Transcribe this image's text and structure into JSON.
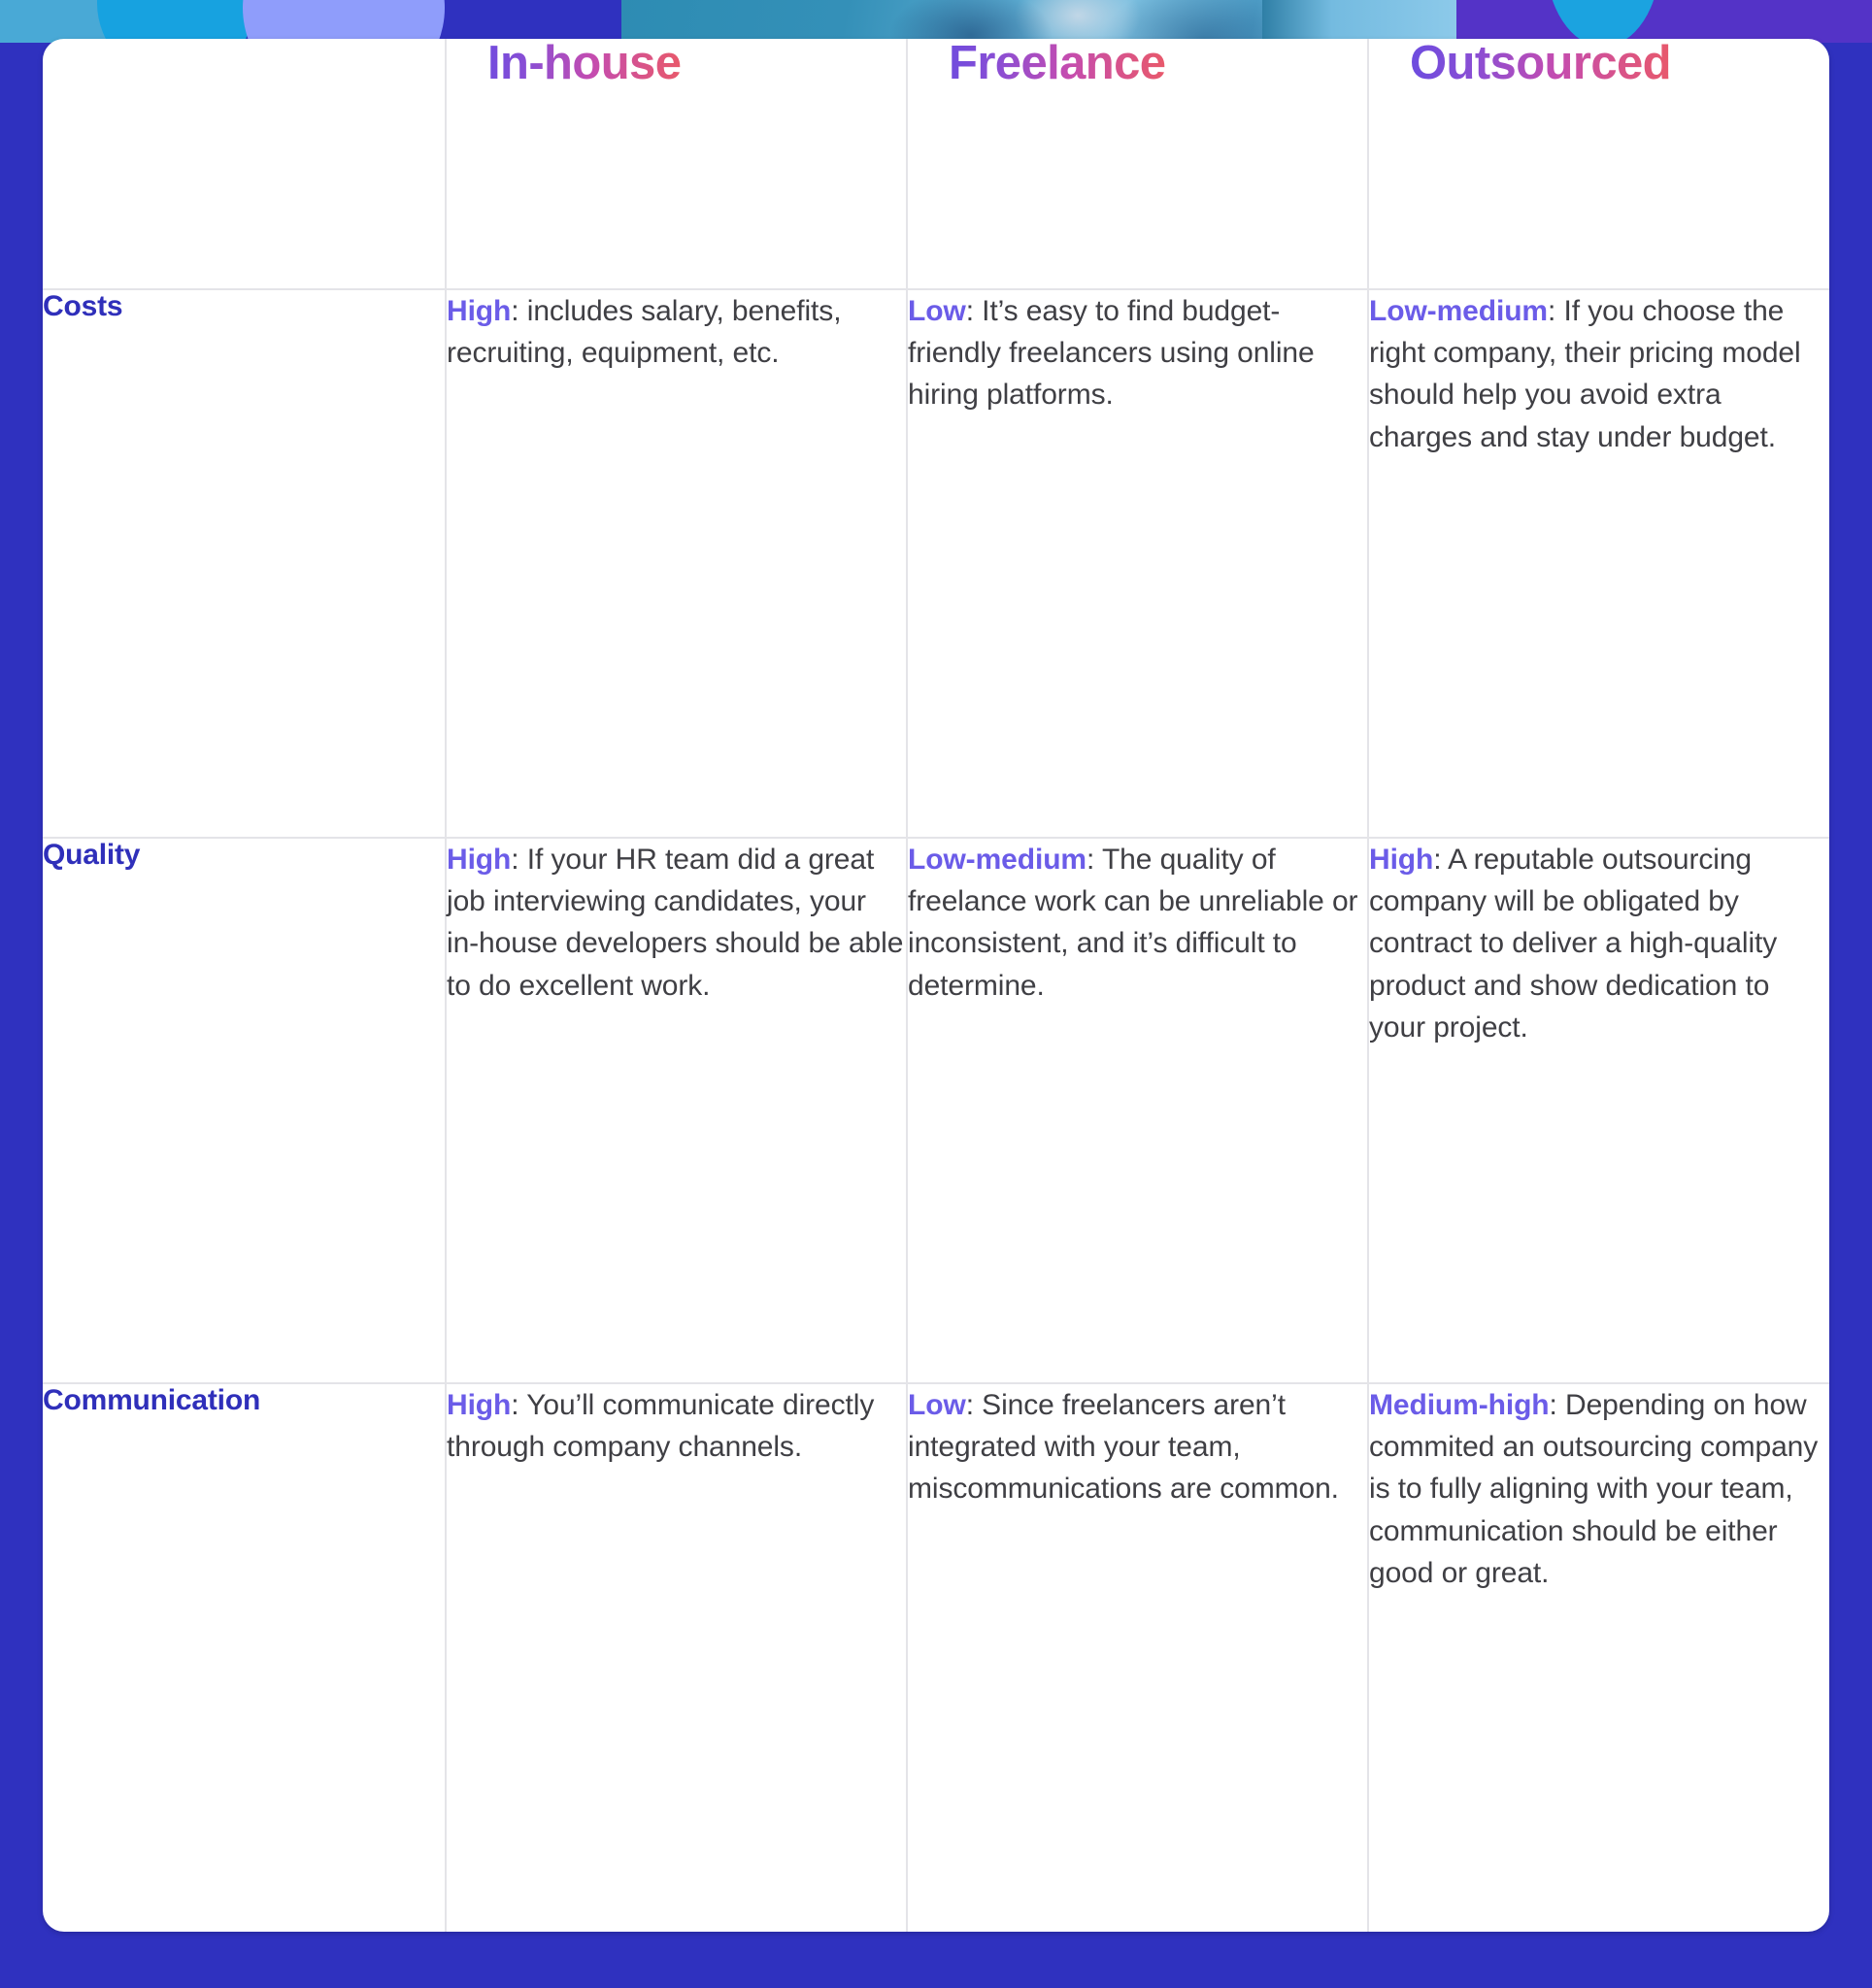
{
  "theme": {
    "page_background": "#2f31bf",
    "card_background": "#ffffff",
    "row_label_color": "#2f2fba",
    "keyword_color": "#6b5ce8",
    "body_text_color": "#3f3f44",
    "grid_line_color": "#e4e4e8",
    "header_gradient_start": "#5a4ae6",
    "header_gradient_end": "#e8596b"
  },
  "table": {
    "corner_label": "",
    "columns": [
      {
        "label": "In-house"
      },
      {
        "label": "Freelance"
      },
      {
        "label": "Outsourced"
      }
    ],
    "rows": [
      {
        "label": "Costs",
        "cells": [
          {
            "keyword": "High",
            "separator": ": ",
            "text": "includes salary, benefits, recruiting, equipment, etc."
          },
          {
            "keyword": "Low",
            "separator": ": ",
            "text": "It’s easy to find budget-friendly freelancers using online hiring platforms."
          },
          {
            "keyword": "Low-medium",
            "separator": ": ",
            "text": "If you choose the right company, their pricing model should help you avoid extra charges and stay under budget."
          }
        ]
      },
      {
        "label": "Quality",
        "cells": [
          {
            "keyword": "High",
            "separator": ": ",
            "text": "If your HR team did a great job interviewing candidates, your in-house developers should be able to do excellent work."
          },
          {
            "keyword": "Low-medium",
            "separator": ": ",
            "text": "The quality of freelance work can be unreliable or inconsistent, and it’s difficult to determine."
          },
          {
            "keyword": "High",
            "separator": ": ",
            "text": "A reputable outsourcing company will be obligated by contract to deliver a high-quality product and show dedication to your project."
          }
        ]
      },
      {
        "label": "Communication",
        "cells": [
          {
            "keyword": "High",
            "separator": ": ",
            "text": "You’ll communicate directly through company channels."
          },
          {
            "keyword": "Low",
            "separator": ": ",
            "text": "Since freelancers aren’t integrated with your team, miscommunications are common."
          },
          {
            "keyword": "Medium-high",
            "separator": ": ",
            "text": "Depending on how commited an outsourcing company is to fully aligning with your team, communication should be either good or great."
          }
        ]
      }
    ]
  }
}
